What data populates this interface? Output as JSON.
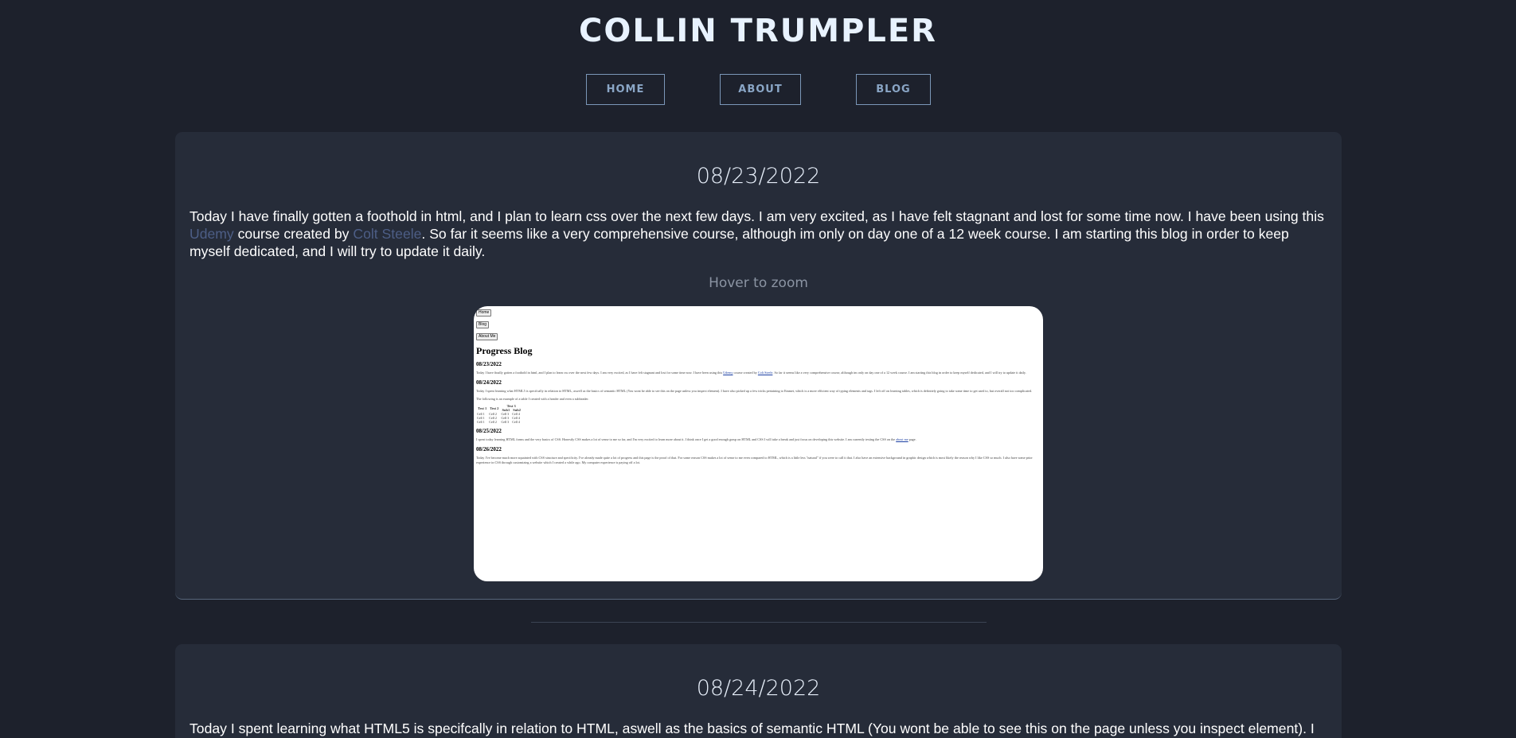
{
  "header": {
    "site_title": "COLLIN TRUMPLER"
  },
  "nav": {
    "items": [
      {
        "label": "HOME"
      },
      {
        "label": "ABOUT"
      },
      {
        "label": "BLOG"
      }
    ]
  },
  "posts": [
    {
      "date": "08/23/2022",
      "body_before_link1": "Today I have finally gotten a foothold in html, and I plan to learn css over the next few days. I am very excited, as I have felt stagnant and lost for some time now. I have been using this ",
      "link1": "Udemy",
      "body_between_links": " course created by ",
      "link2": "Colt Steele",
      "body_after_link2": ". So far it seems like a very comprehensive course, although im only on day one of a 12 week course. I am starting this blog in order to keep myself dedicated, and I will try to update it daily.",
      "hover_hint": "Hover to zoom"
    },
    {
      "date": "08/24/2022",
      "body": "Today I spent learning what HTML5 is specifcally in relation to HTML, aswell as the basics of semantic HTML (You wont be able to see this on the page unless you inspect element). I"
    }
  ],
  "thumbnail": {
    "buttons": [
      "Home",
      "Blog",
      "About Me"
    ],
    "heading": "Progress Blog",
    "entries": [
      {
        "date": "08/23/2022",
        "text_before_link1": "Today I have finally gotten a foothold in html, and I plan to learn css over the next few days. I am very excited, as I have felt stagnant and lost for some time now. I have been using this ",
        "link1": "Udemy",
        "text_between_links": " course created by ",
        "link2": "Colt Steele",
        "text_after_link2": ". So far it seems like a very comprehensive course, although im only on day one of a 12 week course. I am starting this blog in order to keep myself dedicated, and I will try to update it daily."
      },
      {
        "date": "08/24/2022",
        "text": "Today I spent learning what HTML5 is specifcally in relation to HTML, aswell as the basics of semantic HTML (You wont be able to see this on the page unless you inspect element). I have also picked up a few tricks pertaining to Emmet, which is a more efficient way of typing elements and tags. I left off on learning tables, which is definitely going to take some time to get used to, but overall not too complicated.",
        "table_intro": "The following is an example of a table I created with a header and even a subheader.",
        "table_headers": [
          "Test 1",
          "Test 2",
          "Test 3"
        ],
        "table_subheaders": [
          "Sub1",
          "Sub2"
        ],
        "table_rows": [
          [
            "Cell 1",
            "Cell 2",
            "Cell 3",
            "Cell 4"
          ],
          [
            "Cell 1",
            "Cell 2",
            "Cell 3",
            "Cell 4"
          ],
          [
            "Cell 1",
            "Cell 2",
            "Cell 3",
            "Cell 4"
          ]
        ]
      },
      {
        "date": "08/25/2022",
        "text_before_link": "I spent today learning HTML forms and the very basics of CSS. Honestly CSS makes a lot of sense to me so far, and I'm very excited to learn more about it. I think once I get a good enough grasp on HTML and CSS I will take a break and just focus on developing this website. I am currently testing the CSS on the ",
        "link": "about me",
        "text_after_link": " page."
      },
      {
        "date": "08/26/2022",
        "text": "Today I've become much more aquainted with CSS structure and specificity. I've already made quite a lot of progress and this page is the proof of that. For some reason CSS makes a lot of sense to me even compared to HTML, which is a little less \"natural\" if you were to call it that. I also have an extensive background in graphic design which is most likely the reason why I like CSS so much. I also have some prior experience in CSS through customizing a website which I created a while ago. My computer experience is paying off a lot."
      }
    ]
  }
}
